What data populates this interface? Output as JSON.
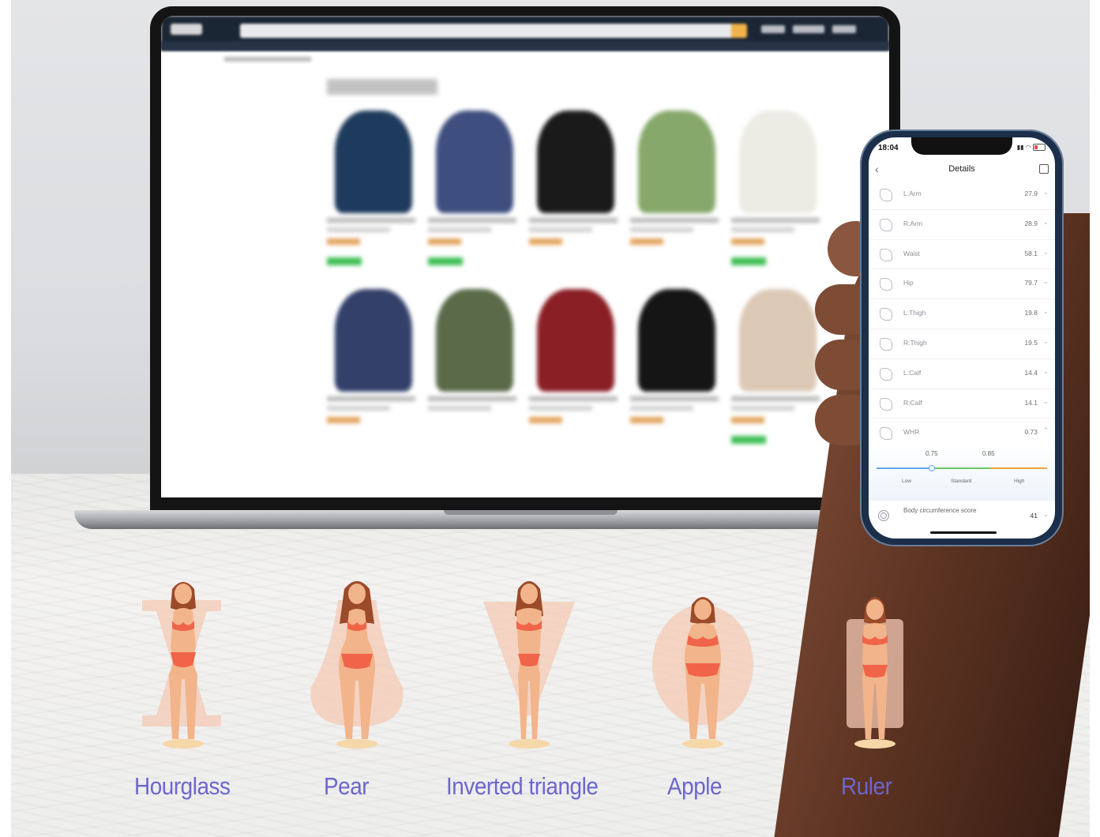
{
  "phone": {
    "time": "18:04",
    "title": "Details",
    "rows": [
      {
        "label": "L:Arm",
        "value": "27.9"
      },
      {
        "label": "R:Arm",
        "value": "28.9"
      },
      {
        "label": "Waist",
        "value": "58.1"
      },
      {
        "label": "Hip",
        "value": "79.7"
      },
      {
        "label": "L:Thigh",
        "value": "19.8"
      },
      {
        "label": "R:Thigh",
        "value": "19.5"
      },
      {
        "label": "L:Calf",
        "value": "14.4"
      },
      {
        "label": "R:Calf",
        "value": "14.1"
      },
      {
        "label": "WHR",
        "value": "0.73"
      }
    ],
    "whr_scale": {
      "ticks": [
        "0.75",
        "0.85"
      ],
      "levels": [
        "Low",
        "Standard",
        "High"
      ],
      "marker_value": 0.73,
      "colors": {
        "low": "#5da9e8",
        "standard": "#6cc56a",
        "high": "#f0a33a"
      }
    },
    "score": {
      "label": "Body circumference score",
      "value": "41"
    }
  },
  "body_shapes": [
    {
      "label": "Hourglass",
      "icon": "hourglass-shape-icon"
    },
    {
      "label": "Pear",
      "icon": "pear-shape-icon"
    },
    {
      "label": "Inverted triangle",
      "icon": "inverted-triangle-shape-icon"
    },
    {
      "label": "Apple",
      "icon": "apple-shape-icon"
    },
    {
      "label": "Ruler",
      "icon": "ruler-shape-icon"
    }
  ],
  "colors": {
    "shape_label": "#6c66cf",
    "swimsuit": "#f0644a",
    "skin": "#f2b48a",
    "hair": "#9b4a2a",
    "shape_overlay": "#f4c9b4"
  }
}
